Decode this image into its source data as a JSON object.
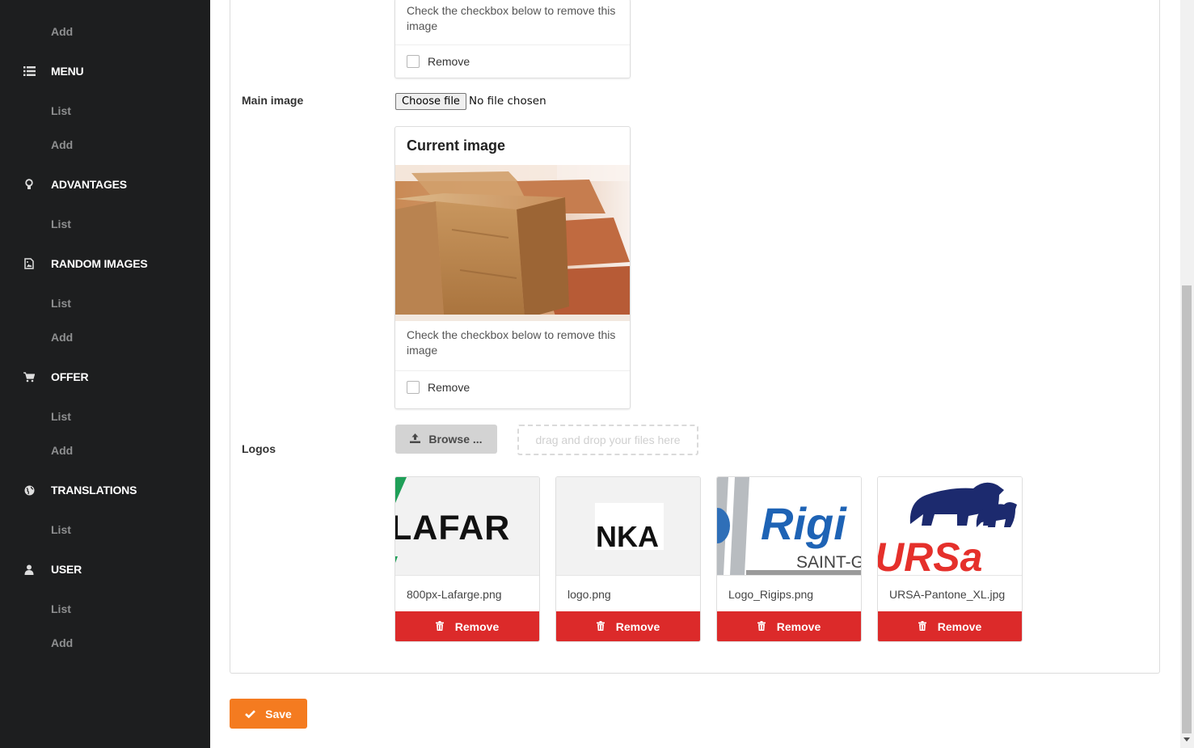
{
  "sidebar": {
    "items_top": [
      {
        "label": "Add"
      }
    ],
    "menu": {
      "label": "MENU",
      "icon": "list-icon",
      "sub": [
        "List",
        "Add"
      ]
    },
    "advantages": {
      "label": "ADVANTAGES",
      "icon": "lightbulb-icon",
      "sub": [
        "List"
      ]
    },
    "random_images": {
      "label": "RANDOM IMAGES",
      "icon": "image-file-icon",
      "sub": [
        "List",
        "Add"
      ]
    },
    "offer": {
      "label": "OFFER",
      "icon": "cart-icon",
      "sub": [
        "List",
        "Add"
      ]
    },
    "translations": {
      "label": "TRANSLATIONS",
      "icon": "globe-icon",
      "sub": [
        "List"
      ]
    },
    "user": {
      "label": "USER",
      "icon": "user-icon",
      "sub": [
        "List",
        "Add"
      ]
    }
  },
  "top_card": {
    "hint": "Check the checkbox below to remove this image",
    "remove_label": "Remove"
  },
  "main_image": {
    "label": "Main image",
    "choose_button": "Choose file",
    "file_status": "No file chosen",
    "card_title": "Current image",
    "hint": "Check the checkbox below to remove this image",
    "remove_label": "Remove"
  },
  "logos": {
    "label": "Logos",
    "browse_label": "Browse ...",
    "dropzone_text": "drag and drop your files here",
    "files": [
      {
        "name": "800px-Lafarge.png",
        "remove": "Remove"
      },
      {
        "name": "logo.png",
        "remove": "Remove"
      },
      {
        "name": "Logo_Rigips.png",
        "remove": "Remove"
      },
      {
        "name": "URSA-Pantone_XL.jpg",
        "remove": "Remove"
      }
    ]
  },
  "save_label": "Save",
  "colors": {
    "sidebar_bg": "#1d1e1f",
    "remove_red": "#dc2a2a",
    "save_orange": "#f47b20"
  }
}
